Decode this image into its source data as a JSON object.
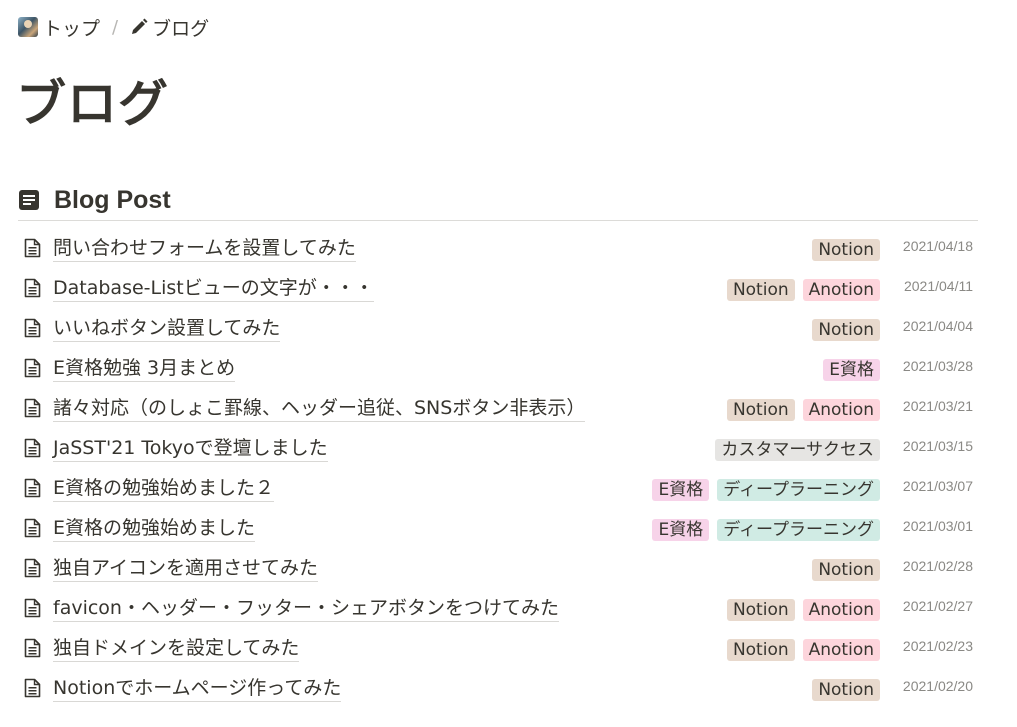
{
  "breadcrumb": {
    "home_label": "トップ",
    "separator": "/",
    "current_label": "ブログ"
  },
  "page": {
    "title": "ブログ"
  },
  "database": {
    "title": "Blog Post",
    "icon": "document-list-icon"
  },
  "tag_colors": {
    "Notion": "#e8d9cd",
    "Anotion": "#fdd5dc",
    "E資格": "#f7d3e9",
    "カスタマーサクセス": "#e6e5e3",
    "ディープラーニング": "#d0ebe4"
  },
  "posts": [
    {
      "title": "問い合わせフォームを設置してみた",
      "tags": [
        "Notion"
      ],
      "date": "2021/04/18"
    },
    {
      "title": "Database-Listビューの文字が・・・",
      "tags": [
        "Notion",
        "Anotion"
      ],
      "date": "2021/04/11"
    },
    {
      "title": "いいねボタン設置してみた",
      "tags": [
        "Notion"
      ],
      "date": "2021/04/04"
    },
    {
      "title": "E資格勉強 3月まとめ",
      "tags": [
        "E資格"
      ],
      "date": "2021/03/28"
    },
    {
      "title": "諸々対応（のしょこ罫線、ヘッダー追従、SNSボタン非表示）",
      "tags": [
        "Notion",
        "Anotion"
      ],
      "date": "2021/03/21"
    },
    {
      "title": "JaSST'21 Tokyoで登壇しました",
      "tags": [
        "カスタマーサクセス"
      ],
      "date": "2021/03/15"
    },
    {
      "title": "E資格の勉強始めました２",
      "tags": [
        "E資格",
        "ディープラーニング"
      ],
      "date": "2021/03/07"
    },
    {
      "title": "E資格の勉強始めました",
      "tags": [
        "E資格",
        "ディープラーニング"
      ],
      "date": "2021/03/01"
    },
    {
      "title": "独自アイコンを適用させてみた",
      "tags": [
        "Notion"
      ],
      "date": "2021/02/28"
    },
    {
      "title": "favicon・ヘッダー・フッター・シェアボタンをつけてみた",
      "tags": [
        "Notion",
        "Anotion"
      ],
      "date": "2021/02/27"
    },
    {
      "title": "独自ドメインを設定してみた",
      "tags": [
        "Notion",
        "Anotion"
      ],
      "date": "2021/02/23"
    },
    {
      "title": "Notionでホームページ作ってみた",
      "tags": [
        "Notion"
      ],
      "date": "2021/02/20"
    }
  ]
}
